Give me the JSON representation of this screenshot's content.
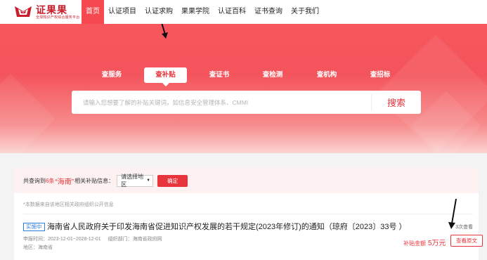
{
  "nav": {
    "logo_title": "证果果",
    "logo_sub": "全球知识产权综合服务平台",
    "items": [
      {
        "label": "首页",
        "active": true
      },
      {
        "label": "认证项目",
        "active": false
      },
      {
        "label": "认证求购",
        "active": false
      },
      {
        "label": "果果学院",
        "active": false
      },
      {
        "label": "认证百科",
        "active": false
      },
      {
        "label": "证书查询",
        "active": false
      },
      {
        "label": "关于我们",
        "active": false
      }
    ]
  },
  "hero": {
    "tabs": [
      {
        "label": "查服务",
        "active": false
      },
      {
        "label": "查补贴",
        "active": true
      },
      {
        "label": "查证书",
        "active": false
      },
      {
        "label": "查检测",
        "active": false
      },
      {
        "label": "查机构",
        "active": false
      },
      {
        "label": "查招标",
        "active": false
      }
    ],
    "search_placeholder": "请输入您想要了解的补贴关键词，如信息安全管理体系、CMMI",
    "search_button": "搜索"
  },
  "filter": {
    "prefix": "共查询到",
    "count": "6条",
    "keyword": "“海南”",
    "suffix": "相关补贴信息：",
    "region_select": "请选择地区",
    "confirm": "确定"
  },
  "note": "*本数据来自该地区相关政府组织公开信息",
  "items": [
    {
      "badge": "实施中",
      "title": "海南省人民政府关于印发海南省促进知识产权发展的若干规定(2023年修订)的通知（琼府〔2023〕33号 ）",
      "views": "3次查看",
      "date_label": "申报时间：",
      "date_value": "2023-12-01~2028-12-01",
      "org_label": "组织部门：",
      "org_value": "海南省政府网",
      "region_label": "地区：",
      "region_value": "海南省",
      "amount_label": "补贴金额",
      "amount_value": "5万元",
      "button": "查看原文"
    }
  ],
  "colors": {
    "accent": "#e8343c",
    "nav_active": "#f5484f",
    "badge_blue": "#2f7de1"
  }
}
